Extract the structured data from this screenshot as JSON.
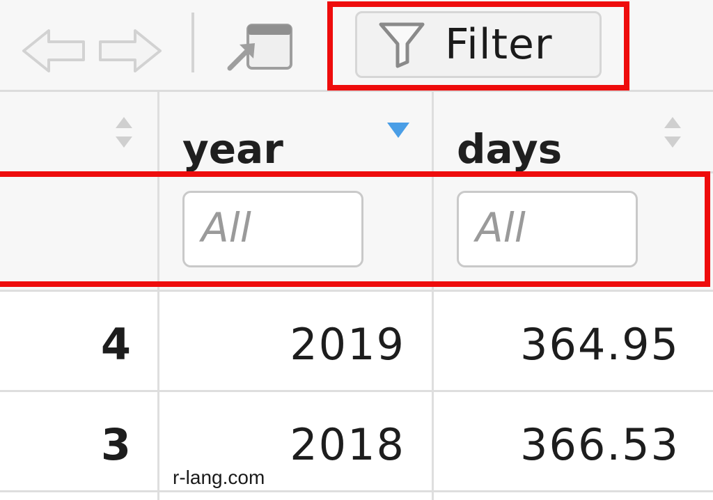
{
  "toolbar": {
    "back_icon": "arrow-left-icon",
    "forward_icon": "arrow-right-icon",
    "popout_icon": "popout-window-icon",
    "filter_icon": "funnel-icon",
    "filter_label": "Filter"
  },
  "table": {
    "columns": [
      {
        "label": "",
        "sort_state": "unsorted"
      },
      {
        "label": "year",
        "sort_state": "descending"
      },
      {
        "label": "days",
        "sort_state": "unsorted"
      }
    ],
    "filters": [
      {
        "placeholder": "All"
      },
      {
        "placeholder": "All"
      }
    ],
    "rows": [
      {
        "rowname": "4",
        "year": "2019",
        "days": "364.95"
      },
      {
        "rowname": "3",
        "year": "2018",
        "days": "366.53"
      }
    ]
  },
  "highlight_color": "#ee0c0c",
  "sort_active_color": "#4a9ee6",
  "watermark": "r-lang.com"
}
